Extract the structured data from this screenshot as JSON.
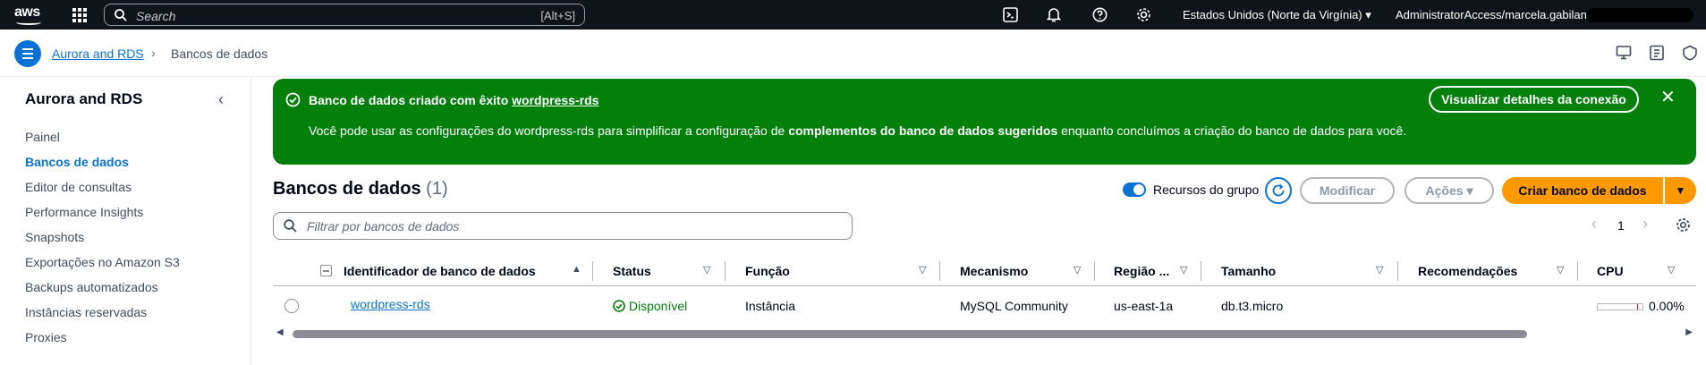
{
  "topbar": {
    "logo_text": "aws",
    "search_placeholder": "Search",
    "search_shortcut": "[Alt+S]",
    "region": "Estados Unidos (Norte da Virgínia) ▾",
    "account": "AdministratorAccess/marcela.gabilan"
  },
  "breadcrumb": {
    "items": [
      "Aurora and RDS",
      "Bancos de dados"
    ],
    "separator": "›"
  },
  "sidebar": {
    "title": "Aurora and RDS",
    "collapse_glyph": "‹",
    "items": [
      {
        "label": "Painel",
        "active": false
      },
      {
        "label": "Bancos de dados",
        "active": true
      },
      {
        "label": "Editor de consultas",
        "active": false
      },
      {
        "label": "Performance Insights",
        "active": false
      },
      {
        "label": "Snapshots",
        "active": false
      },
      {
        "label": "Exportações no Amazon S3",
        "active": false
      },
      {
        "label": "Backups automatizados",
        "active": false
      },
      {
        "label": "Instâncias reservadas",
        "active": false
      },
      {
        "label": "Proxies",
        "active": false
      }
    ]
  },
  "flash": {
    "title_prefix": "Banco de dados criado com êxito ",
    "title_link": "wordpress-rds",
    "message_prefix": "Você pode usar as configurações do wordpress-rds para simplificar a configuração de ",
    "message_bold": "complementos do banco de dados sugeridos",
    "message_suffix": " enquanto concluímos a criação do banco de dados para você.",
    "button": "Visualizar detalhes da conexão",
    "close_glyph": "✕",
    "color": "#037f0c"
  },
  "databases": {
    "title": "Bancos de dados",
    "count": "(1)",
    "toggle_label": "Recursos do grupo",
    "modify_label": "Modificar",
    "actions_label": "Ações ▾",
    "create_label": "Criar banco de dados",
    "create_dd_glyph": "▼",
    "filter_placeholder": "Filtrar por bancos de dados",
    "page_prev": "‹",
    "page_number": "1",
    "page_next": "›",
    "columns": [
      "Identificador de banco de dados",
      "Status",
      "Função",
      "Mecanismo",
      "Região ...",
      "Tamanho",
      "Recomendações",
      "CPU"
    ],
    "sort_asc_glyph": "▲",
    "filter_glyph": "▽",
    "rows": [
      {
        "identifier": "wordpress-rds",
        "status": "Disponível",
        "role": "Instância",
        "engine": "MySQL Community",
        "region": "us-east-1a",
        "size": "db.t3.micro",
        "recommendations": "",
        "cpu": "0.00%",
        "cpu_fraction": 0.0
      }
    ]
  },
  "colors": {
    "accent": "#0972d3",
    "primary_button": "#ff9900",
    "topbar": "#0f141a",
    "success": "#037f0c"
  }
}
